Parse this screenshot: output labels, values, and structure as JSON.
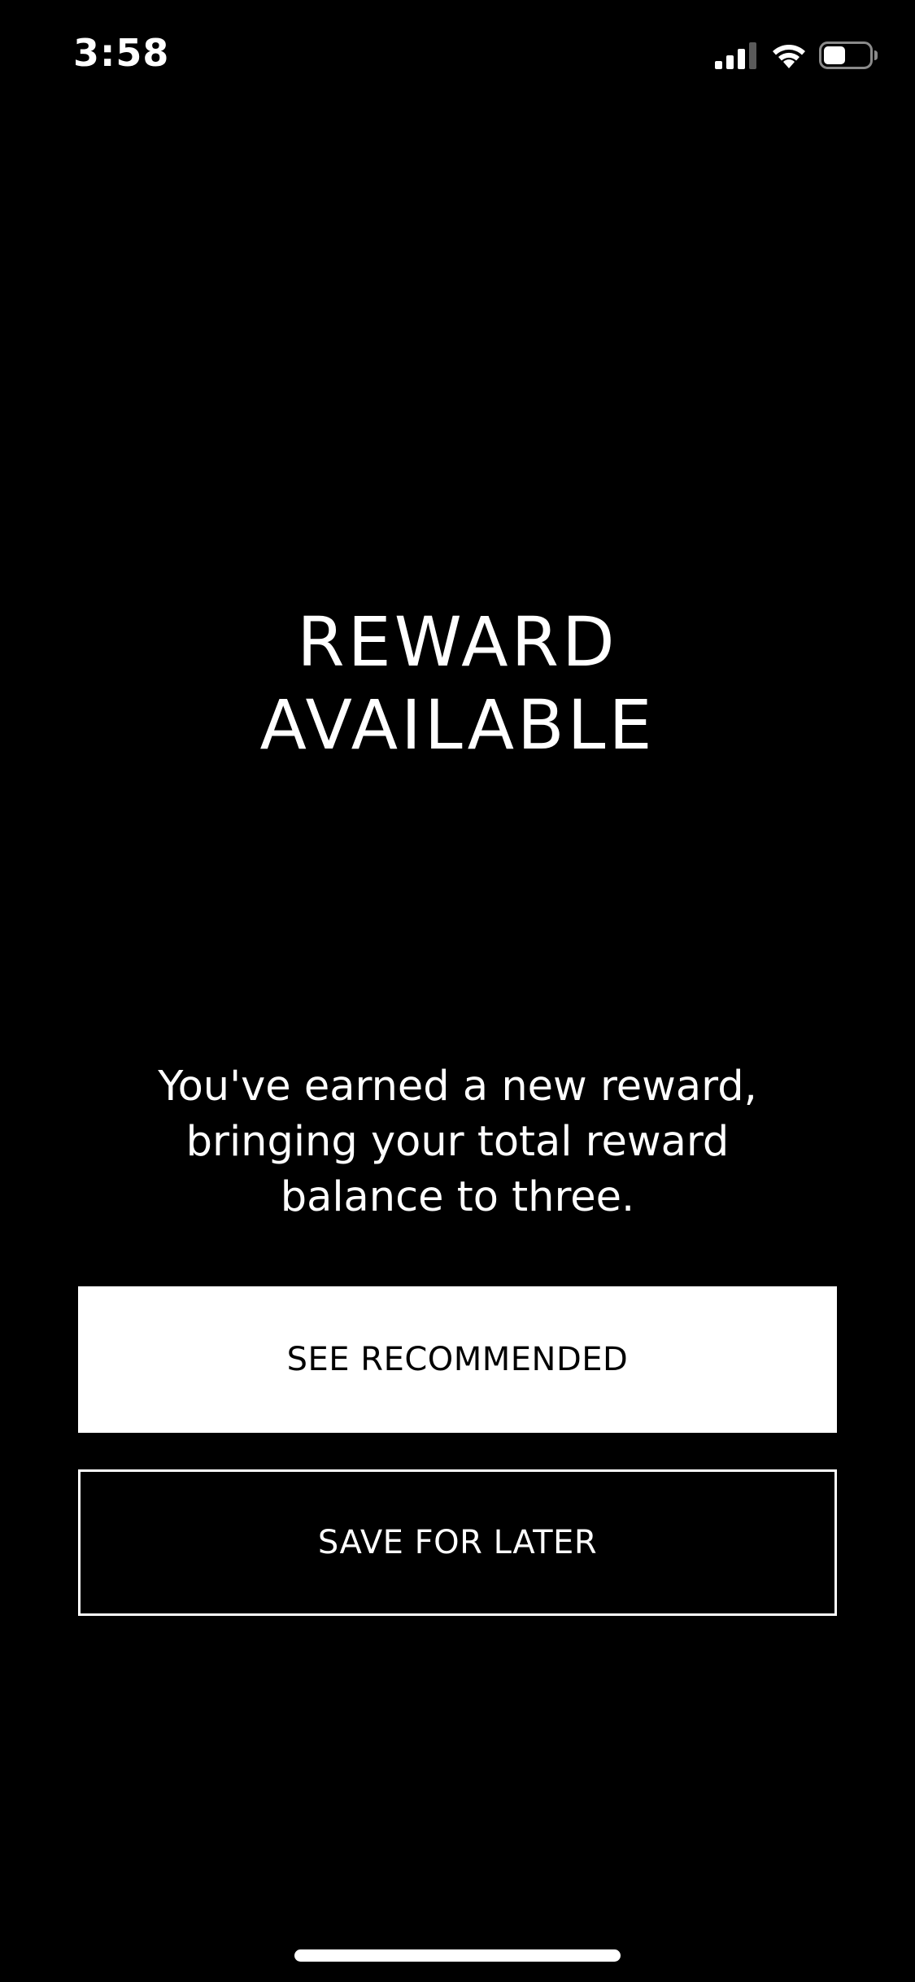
{
  "status_bar": {
    "time": "3:58",
    "icons": [
      "cellular-signal-icon",
      "wifi-icon",
      "battery-icon"
    ]
  },
  "reward": {
    "title_line_1": "REWARD",
    "title_line_2": "AVAILABLE",
    "message_line_1": "You've earned a new reward,",
    "message_line_2": "bringing your total reward",
    "message_line_3": "balance to three."
  },
  "actions": {
    "primary_label": "SEE RECOMMENDED",
    "secondary_label": "SAVE FOR LATER"
  },
  "colors": {
    "background": "#000000",
    "text": "#ffffff",
    "primary_button_bg": "#ffffff",
    "primary_button_text": "#000000"
  }
}
